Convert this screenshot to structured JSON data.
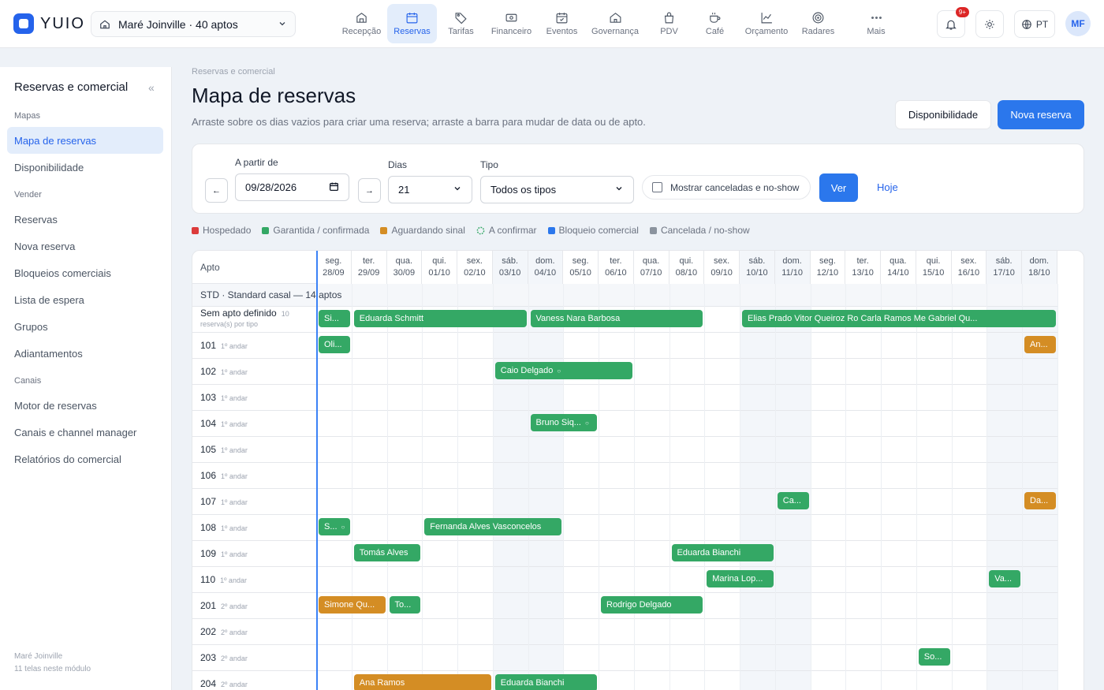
{
  "brand": {
    "name": "YUIO",
    "color": "#2563eb"
  },
  "hotel_selector": {
    "label": "Maré Joinville · 40 aptos",
    "icon": "home-icon"
  },
  "nav": [
    {
      "label": "Recepção",
      "icon": "reception-icon",
      "active": false
    },
    {
      "label": "Reservas",
      "icon": "calendar-icon",
      "active": true
    },
    {
      "label": "Tarifas",
      "icon": "tag-icon",
      "active": false
    },
    {
      "label": "Financeiro",
      "icon": "money-icon",
      "active": false
    },
    {
      "label": "Eventos",
      "icon": "event-icon",
      "active": false
    },
    {
      "label": "Governança",
      "icon": "house-icon",
      "active": false
    },
    {
      "label": "PDV",
      "icon": "bag-icon",
      "active": false
    },
    {
      "label": "Café",
      "icon": "coffee-icon",
      "active": false
    },
    {
      "label": "Orçamento",
      "icon": "chart-line-icon",
      "active": false
    },
    {
      "label": "Radares",
      "icon": "target-icon",
      "active": false
    },
    {
      "label": "Mais",
      "icon": "more-icon",
      "active": false
    }
  ],
  "header": {
    "notifications_badge": "9+",
    "language": "PT",
    "avatar_initials": "MF"
  },
  "sidebar": {
    "title": "Reservas e comercial",
    "collapse_glyph": "«",
    "sections": [
      {
        "label": "Mapas",
        "items": [
          {
            "label": "Mapa de reservas",
            "active": true
          },
          {
            "label": "Disponibilidade",
            "active": false
          }
        ]
      },
      {
        "label": "Vender",
        "items": [
          {
            "label": "Reservas",
            "active": false
          },
          {
            "label": "Nova reserva",
            "active": false
          },
          {
            "label": "Bloqueios comerciais",
            "active": false
          },
          {
            "label": "Lista de espera",
            "active": false
          },
          {
            "label": "Grupos",
            "active": false
          },
          {
            "label": "Adiantamentos",
            "active": false
          }
        ]
      },
      {
        "label": "Canais",
        "items": [
          {
            "label": "Motor de reservas",
            "active": false
          },
          {
            "label": "Canais e channel manager",
            "active": false
          },
          {
            "label": "Relatórios do comercial",
            "active": false
          }
        ]
      }
    ],
    "footer_line1": "Maré Joinville",
    "footer_line2": "11 telas neste módulo"
  },
  "page": {
    "breadcrumb": "Reservas e comercial",
    "title": "Mapa de reservas",
    "subtitle": "Arraste sobre os dias vazios para criar uma reserva; arraste a barra para mudar de data ou de apto.",
    "btn_availability": "Disponibilidade",
    "btn_new": "Nova reserva"
  },
  "filters": {
    "prev_glyph": "←",
    "next_glyph": "→",
    "date_label": "A partir de",
    "date_value": "09/28/2026",
    "days_label": "Dias",
    "days_value": "21",
    "type_label": "Tipo",
    "type_value": "Todos os tipos",
    "show_cancelled_label": "Mostrar canceladas e no-show",
    "show_cancelled_checked": false,
    "ver_label": "Ver",
    "hoje_label": "Hoje"
  },
  "legend": [
    {
      "label": "Hospedado",
      "color": "#dc3b3b",
      "kind": "square"
    },
    {
      "label": "Garantida / confirmada",
      "color": "#34a865",
      "kind": "square"
    },
    {
      "label": "Aguardando sinal",
      "color": "#d48d24",
      "kind": "square"
    },
    {
      "label": "A confirmar",
      "color": "#34a865",
      "kind": "dashed-circle"
    },
    {
      "label": "Bloqueio comercial",
      "color": "#2b77ec",
      "kind": "square"
    },
    {
      "label": "Cancelada / no-show",
      "color": "#8b939e",
      "kind": "square"
    }
  ],
  "map": {
    "apto_header": "Apto",
    "days": [
      {
        "dow": "seg.",
        "date": "28/09",
        "weekend": false
      },
      {
        "dow": "ter.",
        "date": "29/09",
        "weekend": false
      },
      {
        "dow": "qua.",
        "date": "30/09",
        "weekend": false
      },
      {
        "dow": "qui.",
        "date": "01/10",
        "weekend": false
      },
      {
        "dow": "sex.",
        "date": "02/10",
        "weekend": false
      },
      {
        "dow": "sáb.",
        "date": "03/10",
        "weekend": true
      },
      {
        "dow": "dom.",
        "date": "04/10",
        "weekend": true
      },
      {
        "dow": "seg.",
        "date": "05/10",
        "weekend": false
      },
      {
        "dow": "ter.",
        "date": "06/10",
        "weekend": false
      },
      {
        "dow": "qua.",
        "date": "07/10",
        "weekend": false
      },
      {
        "dow": "qui.",
        "date": "08/10",
        "weekend": false
      },
      {
        "dow": "sex.",
        "date": "09/10",
        "weekend": false
      },
      {
        "dow": "sáb.",
        "date": "10/10",
        "weekend": true
      },
      {
        "dow": "dom.",
        "date": "11/10",
        "weekend": true
      },
      {
        "dow": "seg.",
        "date": "12/10",
        "weekend": false
      },
      {
        "dow": "ter.",
        "date": "13/10",
        "weekend": false
      },
      {
        "dow": "qua.",
        "date": "14/10",
        "weekend": false
      },
      {
        "dow": "qui.",
        "date": "15/10",
        "weekend": false
      },
      {
        "dow": "sex.",
        "date": "16/10",
        "weekend": false
      },
      {
        "dow": "sáb.",
        "date": "17/10",
        "weekend": true
      },
      {
        "dow": "dom.",
        "date": "18/10",
        "weekend": true
      }
    ],
    "group_label": "STD · Standard casal — 14 aptos",
    "unassigned": {
      "label": "Sem apto definido",
      "count": "10",
      "sub": "reserva(s) por tipo"
    },
    "rooms": [
      {
        "number": "101",
        "floor": "1º andar"
      },
      {
        "number": "102",
        "floor": "1º andar"
      },
      {
        "number": "103",
        "floor": "1º andar"
      },
      {
        "number": "104",
        "floor": "1º andar"
      },
      {
        "number": "105",
        "floor": "1º andar"
      },
      {
        "number": "106",
        "floor": "1º andar"
      },
      {
        "number": "107",
        "floor": "1º andar"
      },
      {
        "number": "108",
        "floor": "1º andar"
      },
      {
        "number": "109",
        "floor": "1º andar"
      },
      {
        "number": "110",
        "floor": "1º andar"
      },
      {
        "number": "201",
        "floor": "2º andar"
      },
      {
        "number": "202",
        "floor": "2º andar"
      },
      {
        "number": "203",
        "floor": "2º andar"
      },
      {
        "number": "204",
        "floor": "2º andar"
      }
    ],
    "reservations": [
      {
        "row": 0,
        "start": 0,
        "span": 1,
        "label": "Si...",
        "status": "green",
        "pending": false
      },
      {
        "row": 0,
        "start": 1,
        "span": 5,
        "label": "Eduarda Schmitt",
        "status": "green",
        "pending": false
      },
      {
        "row": 0,
        "start": 6,
        "span": 5,
        "label": "Vaness  Nara Barbosa",
        "status": "green",
        "pending": false
      },
      {
        "row": 0,
        "start": 12,
        "span": 9,
        "label": "Elias Prado         Vitor Queiroz Ro  Carla Ramos Me  Gabriel Qu...",
        "status": "green",
        "pending": false
      },
      {
        "row": 1,
        "start": 0,
        "span": 1,
        "label": "Oli...",
        "status": "green",
        "pending": false
      },
      {
        "row": 1,
        "start": 20,
        "span": 1,
        "label": "An...",
        "status": "orange",
        "pending": false
      },
      {
        "row": 2,
        "start": 5,
        "span": 4,
        "label": "Caio Delgado",
        "status": "green",
        "pending": true
      },
      {
        "row": 4,
        "start": 6,
        "span": 2,
        "label": "Bruno Siq...",
        "status": "green",
        "pending": true
      },
      {
        "row": 7,
        "start": 13,
        "span": 1,
        "label": "Ca...",
        "status": "green",
        "pending": false
      },
      {
        "row": 7,
        "start": 20,
        "span": 1,
        "label": "Da...",
        "status": "orange",
        "pending": false
      },
      {
        "row": 8,
        "start": 0,
        "span": 1,
        "label": "S...",
        "status": "green",
        "pending": true
      },
      {
        "row": 8,
        "start": 3,
        "span": 4,
        "label": "Fernanda Alves Vasconcelos",
        "status": "green",
        "pending": false
      },
      {
        "row": 9,
        "start": 1,
        "span": 2,
        "label": "Tomás Alves",
        "status": "green",
        "pending": false
      },
      {
        "row": 9,
        "start": 10,
        "span": 3,
        "label": "Eduarda Bianchi",
        "status": "green",
        "pending": false
      },
      {
        "row": 10,
        "start": 11,
        "span": 2,
        "label": "Marina Lop...",
        "status": "green",
        "pending": false
      },
      {
        "row": 10,
        "start": 19,
        "span": 1,
        "label": "Va...",
        "status": "green",
        "pending": false
      },
      {
        "row": 11,
        "start": 0,
        "span": 2,
        "label": "Simone Qu...",
        "status": "orange",
        "pending": false
      },
      {
        "row": 11,
        "start": 2,
        "span": 1,
        "label": "To...",
        "status": "green",
        "pending": false
      },
      {
        "row": 11,
        "start": 8,
        "span": 3,
        "label": "Rodrigo Delgado",
        "status": "green",
        "pending": false
      },
      {
        "row": 13,
        "start": 17,
        "span": 1,
        "label": "So...",
        "status": "green",
        "pending": false
      },
      {
        "row": 14,
        "start": 1,
        "span": 4,
        "label": "Ana Ramos",
        "status": "orange",
        "pending": false
      },
      {
        "row": 14,
        "start": 5,
        "span": 3,
        "label": "Eduarda Bianchi",
        "status": "green",
        "pending": false
      }
    ]
  }
}
